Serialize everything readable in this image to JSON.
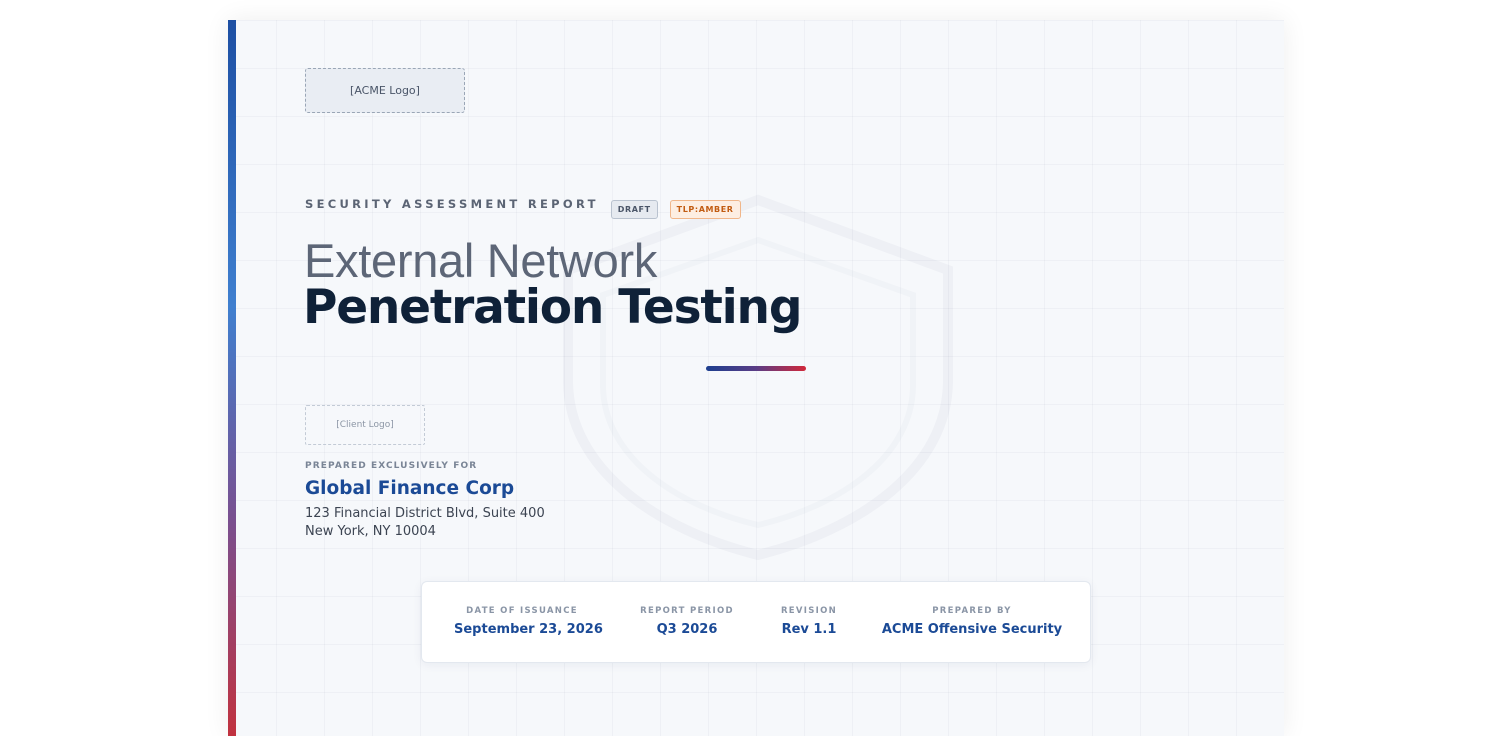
{
  "header": {
    "logo_placeholder": "[ACME Logo]"
  },
  "report": {
    "eyebrow": "SECURITY ASSESSMENT REPORT",
    "badges": {
      "draft": "DRAFT",
      "tlp": "TLP:AMBER"
    },
    "title_line1": "External Network",
    "title_line2": "Penetration Testing"
  },
  "client": {
    "logo_placeholder": "[Client Logo]",
    "prepared_for_label": "PREPARED EXCLUSIVELY FOR",
    "name": "Global Finance Corp",
    "address_line1": "123 Financial District Blvd, Suite 400",
    "address_line2": "New York, NY 10004"
  },
  "meta": {
    "issuance_label": "DATE OF ISSUANCE",
    "issuance_value": "September 23, 2026",
    "period_label": "REPORT PERIOD",
    "period_value": "Q3 2026",
    "revision_label": "REVISION",
    "revision_value": "Rev 1.1",
    "prepared_by_label": "PREPARED BY",
    "prepared_by_value": "ACME Offensive Security"
  },
  "colors": {
    "accent_blue": "#1b4a96",
    "accent_red": "#d1283a",
    "title_dark": "#0f2138",
    "tlp_amber": "#c25c12"
  }
}
